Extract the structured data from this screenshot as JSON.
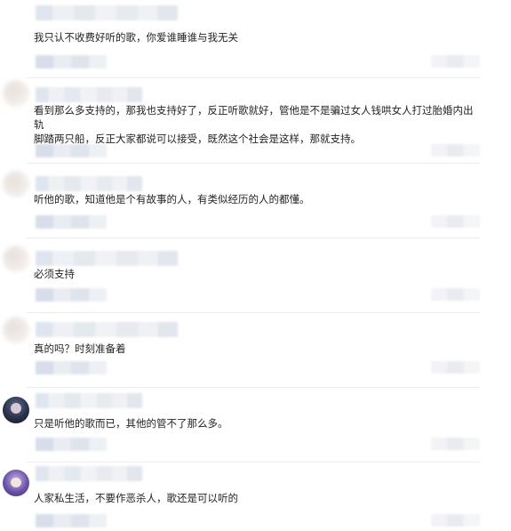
{
  "comments": [
    {
      "id": 1,
      "text": "我只认不收费好听的歌，你爱谁睡谁与我无关"
    },
    {
      "id": 2,
      "text": "看到那么多支持的，那我也支持好了，反正听歌就好，管他是不是骗过女人钱哄女人打过胎婚内出轨\n脚踏两只船，反正大家都说可以接受，既然这个社会是这样，那就支持。"
    },
    {
      "id": 3,
      "text": "听他的歌，知道他是个有故事的人，有类似经历的人的都懂。"
    },
    {
      "id": 4,
      "text": "必须支持"
    },
    {
      "id": 5,
      "text": "真的吗？时刻准备着"
    },
    {
      "id": 6,
      "text": "只是听他的歌而已，其他的管不了那么多。"
    },
    {
      "id": 7,
      "text": "人家私生活，不要作恶杀人，歌还是可以听的"
    }
  ]
}
